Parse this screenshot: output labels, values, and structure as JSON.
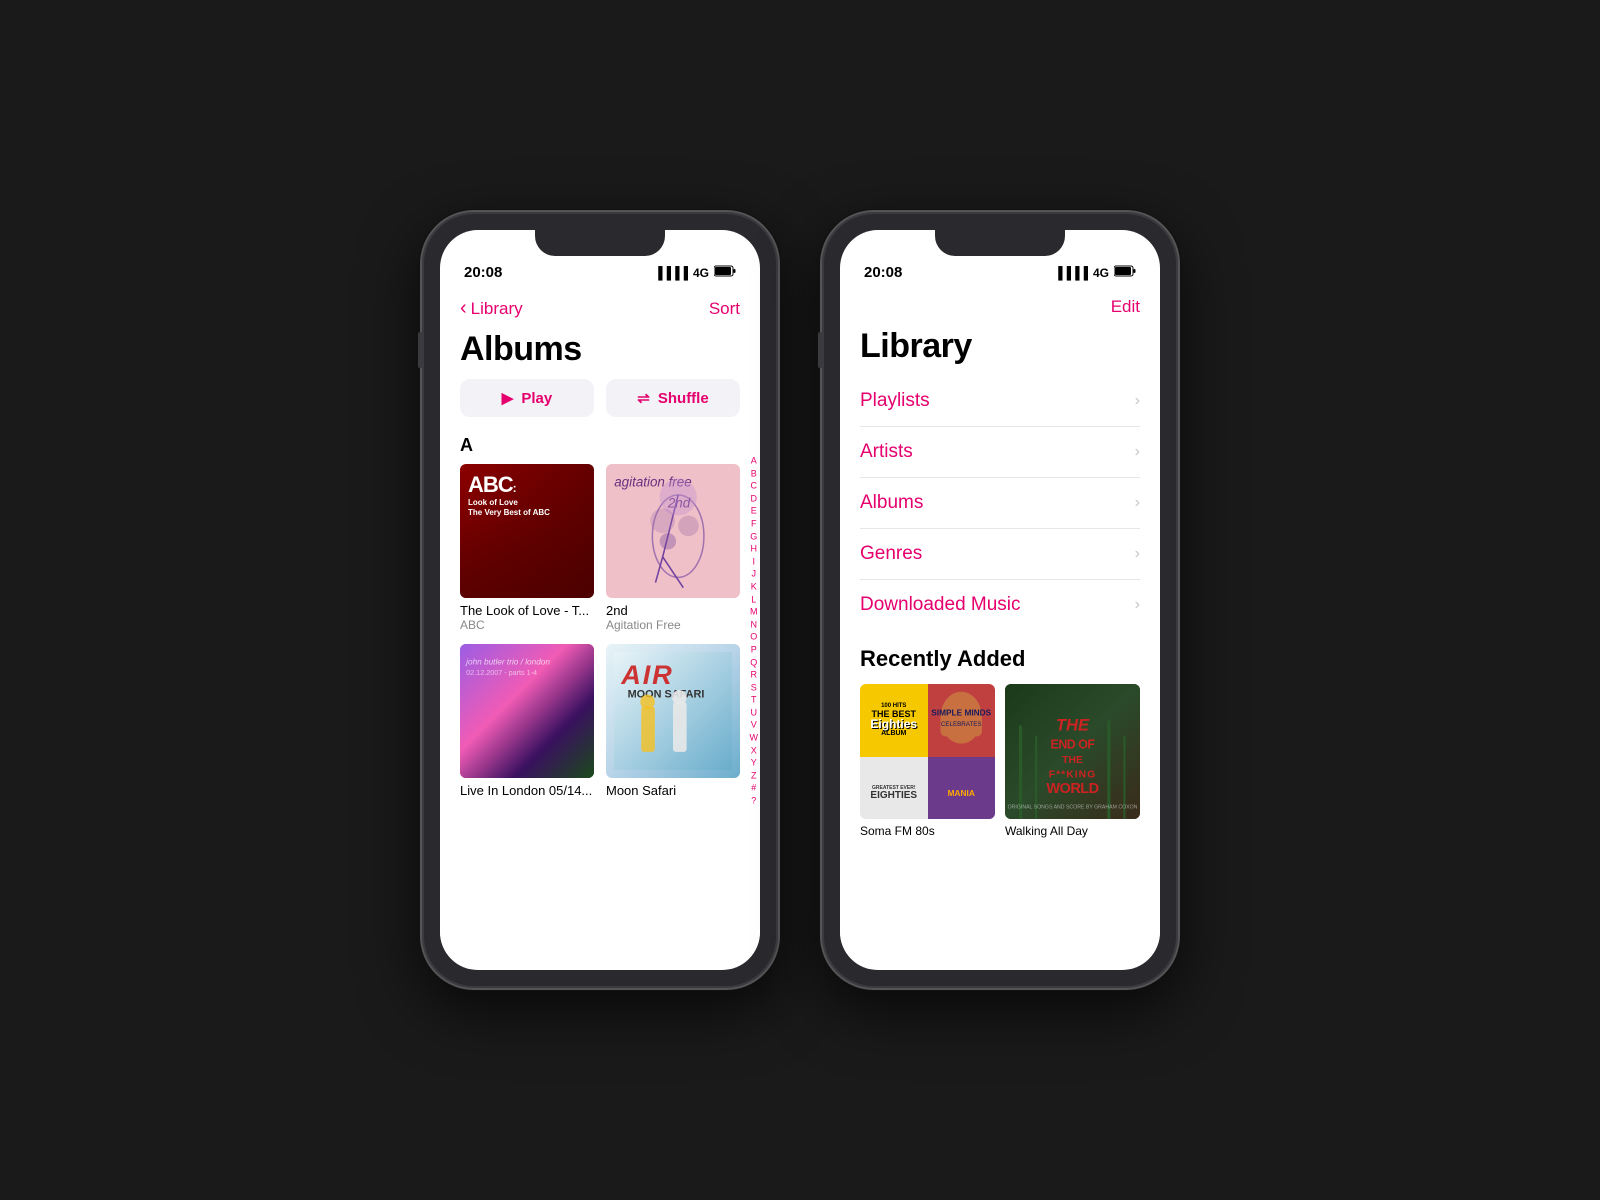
{
  "phone1": {
    "status": {
      "time": "20:08",
      "signal": "▐▐▐▐",
      "network": "4G",
      "battery": "█████"
    },
    "nav": {
      "back_label": "Library",
      "sort_label": "Sort"
    },
    "title": "Albums",
    "buttons": {
      "play": "Play",
      "shuffle": "Shuffle"
    },
    "section_letter": "A",
    "albums": [
      {
        "title": "The Look of Love - T...",
        "artist": "ABC",
        "type": "abc"
      },
      {
        "title": "2nd",
        "artist": "Agitation Free",
        "type": "agitation"
      },
      {
        "title": "Live In London 05/14...",
        "artist": "",
        "type": "london"
      },
      {
        "title": "Moon Safari",
        "artist": "",
        "type": "air"
      }
    ],
    "alphabet": [
      "A",
      "B",
      "C",
      "D",
      "E",
      "F",
      "G",
      "H",
      "I",
      "J",
      "K",
      "L",
      "M",
      "N",
      "O",
      "P",
      "Q",
      "R",
      "S",
      "T",
      "U",
      "V",
      "W",
      "X",
      "Y",
      "Z",
      "#",
      "?"
    ]
  },
  "phone2": {
    "status": {
      "time": "20:08",
      "signal": "▐▐▐▐",
      "network": "4G",
      "battery": "█████"
    },
    "nav": {
      "edit_label": "Edit"
    },
    "title": "Library",
    "items": [
      {
        "label": "Playlists"
      },
      {
        "label": "Artists"
      },
      {
        "label": "Albums"
      },
      {
        "label": "Genres"
      },
      {
        "label": "Downloaded Music"
      }
    ],
    "recently_added_title": "Recently Added",
    "recent_albums": [
      {
        "title": "Soma FM 80s",
        "type": "soma"
      },
      {
        "title": "Walking All Day",
        "type": "walking"
      }
    ]
  }
}
